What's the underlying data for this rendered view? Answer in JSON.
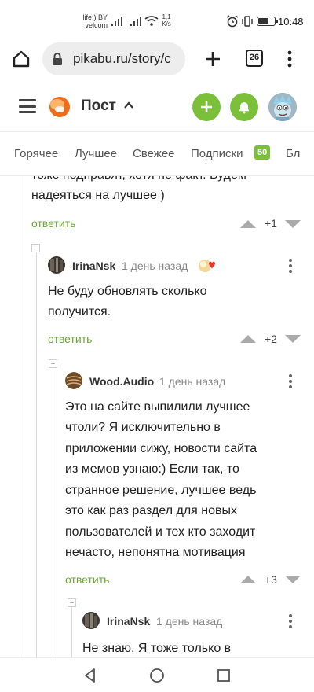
{
  "status_bar": {
    "carrier_line1": "life:) BY",
    "carrier_line2": "velcom",
    "speed_value": "1,1",
    "speed_unit": "K/s",
    "time": "10:48",
    "battery_level": 0.7,
    "icons": [
      "signal-icon",
      "wifi-icon",
      "alarm-icon",
      "vibrate-icon",
      "battery-icon"
    ]
  },
  "browser": {
    "url": "pikabu.ru/story/c",
    "tab_count": "26",
    "icons": [
      "home-icon",
      "lock-icon",
      "plus-icon",
      "tabs-icon",
      "more-vert-icon"
    ]
  },
  "header": {
    "title": "Пост",
    "icons": [
      "hamburger-icon",
      "pikabu-logo",
      "chevron-up-icon",
      "plus-icon",
      "bell-icon",
      "avatar"
    ],
    "accent_color": "#7cbf3b"
  },
  "tabs": {
    "items": [
      "Горячее",
      "Лучшее",
      "Свежее",
      "Подписки",
      "Бл"
    ],
    "subscriptions_count": "50"
  },
  "comments": {
    "top_fragment": {
      "line1": "тоже подправят, хотя не факт. Будем",
      "line2": "надеяться на лучшее )",
      "reply": "ответить",
      "rating": "+1"
    },
    "items": [
      {
        "author": "IrinaNsk",
        "date": "1 день назад",
        "lines": [
          "Не буду обновлять сколько",
          "получится."
        ],
        "reply": "ответить",
        "rating": "+2"
      },
      {
        "author": "Wood.Audio",
        "date": "1 день назад",
        "lines": [
          "Это на сайте выпилили лучшее",
          "чтоли? Я исключительно в",
          "приложении сижу, новости сайта",
          "из мемов узнаю:) Если так, то",
          "странное решение, лучшее ведь",
          "это как раз раздел для новых",
          "пользователей и тех кто заходит",
          "нечасто, непонятна мотивация"
        ],
        "reply": "ответить",
        "rating": "+3"
      },
      {
        "author": "IrinaNsk",
        "date": "1 день назад",
        "lines": [
          "Не знаю. Я тоже только в"
        ]
      }
    ]
  },
  "nav_bar": {
    "icons": [
      "back-icon",
      "home-circle-icon",
      "recents-icon"
    ]
  }
}
